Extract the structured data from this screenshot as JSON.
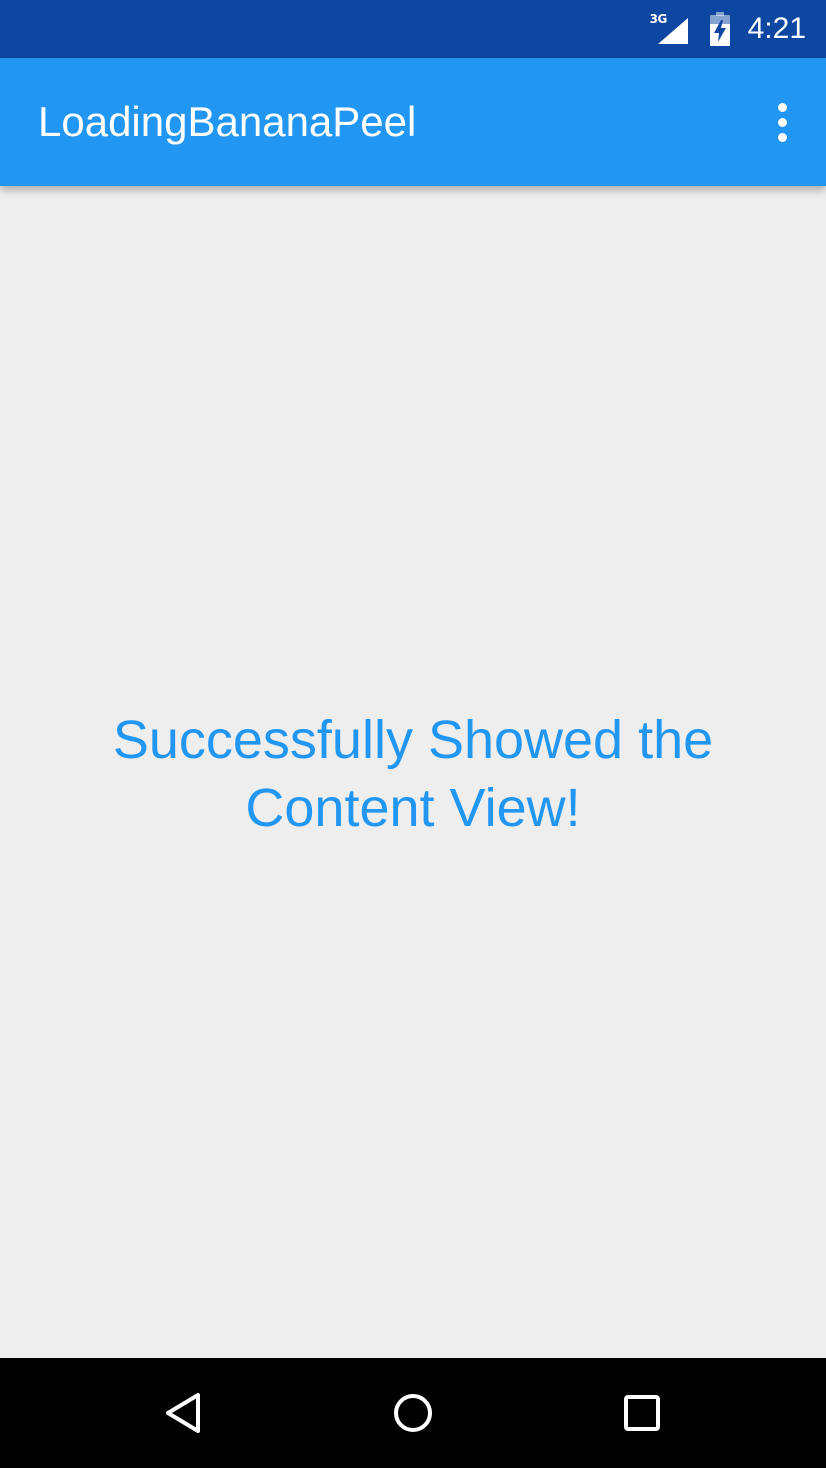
{
  "status_bar": {
    "network_type": "3G",
    "time": "4:21",
    "icons": [
      "signal-icon",
      "battery-charging-icon"
    ]
  },
  "app_bar": {
    "title": "LoadingBananaPeel",
    "overflow_icon": "more-vert-icon"
  },
  "content": {
    "message": "Successfully Showed the Content View!"
  },
  "nav_bar": {
    "icons": [
      "back-icon",
      "home-icon",
      "recents-icon"
    ]
  },
  "colors": {
    "status_bar": "#0d47a1",
    "primary": "#2196f3",
    "background": "#eeeeee",
    "nav_bar": "#000000"
  }
}
